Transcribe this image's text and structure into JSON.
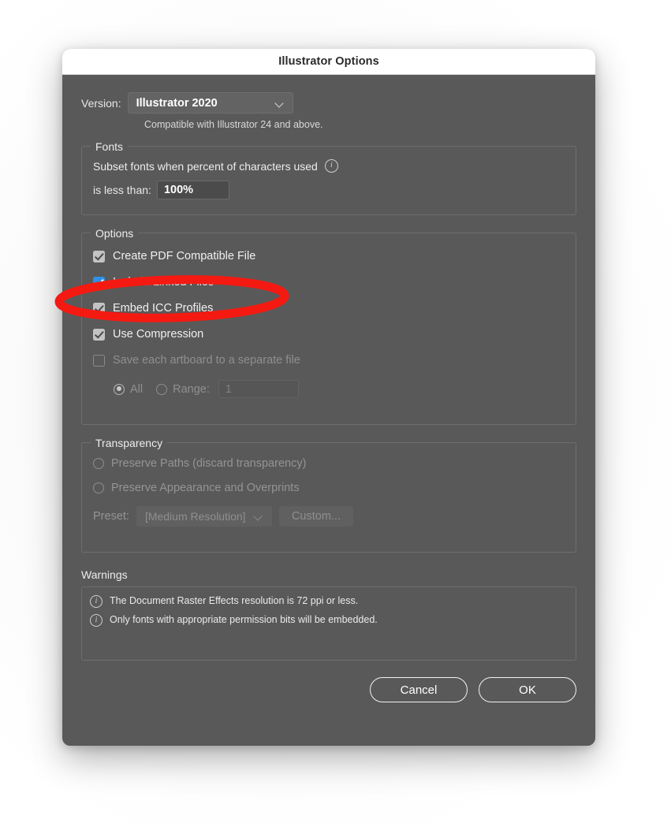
{
  "dialog": {
    "title": "Illustrator Options"
  },
  "version": {
    "label": "Version:",
    "selected": "Illustrator 2020",
    "chevron_icon": "chevron-down-icon",
    "note": "Compatible with Illustrator 24 and above."
  },
  "fonts": {
    "group_title": "Fonts",
    "subset_text": "Subset fonts when percent of characters used",
    "info_icon": "info-icon",
    "less_than_label": "is less than:",
    "percent_value": "100%"
  },
  "options": {
    "group_title": "Options",
    "checkboxes": [
      {
        "label": "Create PDF Compatible File",
        "checked": true,
        "enabled": true,
        "accent": false
      },
      {
        "label": "Include Linked Files",
        "checked": true,
        "enabled": true,
        "accent": true
      },
      {
        "label": "Embed ICC Profiles",
        "checked": true,
        "enabled": true,
        "accent": false
      },
      {
        "label": "Use Compression",
        "checked": true,
        "enabled": true,
        "accent": false
      },
      {
        "label": "Save each artboard to a separate file",
        "checked": false,
        "enabled": false,
        "accent": false
      }
    ],
    "artboard_radios": {
      "all_label": "All",
      "all_selected": true,
      "range_label": "Range:",
      "range_selected": false,
      "range_value": "1"
    }
  },
  "transparency": {
    "group_title": "Transparency",
    "radios": [
      {
        "label": "Preserve Paths (discard transparency)",
        "selected": false
      },
      {
        "label": "Preserve Appearance and Overprints",
        "selected": false
      }
    ],
    "preset_label": "Preset:",
    "preset_value": "[Medium Resolution]",
    "preset_chevron_icon": "chevron-down-icon",
    "custom_button": "Custom..."
  },
  "warnings": {
    "title": "Warnings",
    "items": [
      "The Document Raster Effects resolution is 72 ppi or less.",
      "Only fonts with appropriate permission bits will be embedded."
    ]
  },
  "footer": {
    "cancel_label": "Cancel",
    "ok_label": "OK"
  },
  "annotation": {
    "shape": "ellipse-highlight",
    "color": "#F41A12",
    "targets": "Include Linked Files"
  },
  "colors": {
    "dialog_bg": "#595959",
    "titlebar_bg": "#FFFFFF",
    "accent_checkbox": "#2F8FEA",
    "annotation_red": "#F41A12",
    "text": "#EDEDED",
    "disabled_text": "#8F8F8F"
  }
}
